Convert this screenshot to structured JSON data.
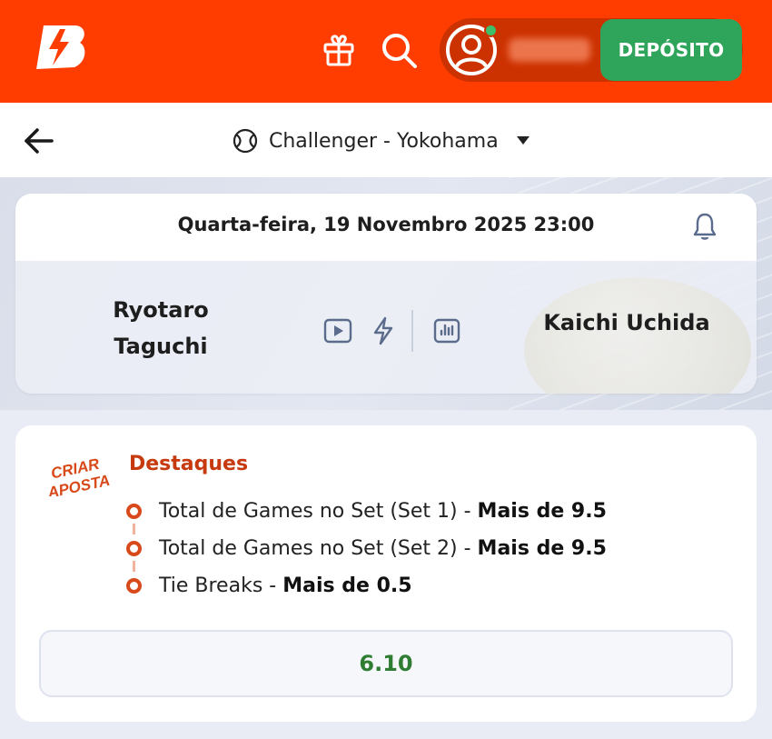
{
  "header": {
    "deposit_label": "DEPÓSITO",
    "accent_color": "#ff3d00",
    "deposit_color": "#2ea55a",
    "icons": [
      "brand-logo-icon",
      "gift-icon",
      "search-icon",
      "user-icon"
    ]
  },
  "subheader": {
    "league": "Challenger - Yokohama",
    "icons": [
      "back-arrow-icon",
      "tennis-ball-icon",
      "caret-down-icon"
    ]
  },
  "event": {
    "datetime": "Quarta-feira, 19 Novembro 2025 23:00",
    "player_home_line1": "Ryotaro",
    "player_home_line2": "Taguchi",
    "player_away": "Kaichi Uchida",
    "icons": [
      "bell-icon",
      "play-video-icon",
      "lightning-icon",
      "stats-icon"
    ]
  },
  "builder": {
    "badge_line1": "CRIAR",
    "badge_line2": "APOSTA",
    "title": "Destaques",
    "legs": [
      {
        "market": "Total de Games no Set (Set 1) - ",
        "selection": "Mais de 9.5"
      },
      {
        "market": "Total de Games no Set (Set 2) - ",
        "selection": "Mais de 9.5"
      },
      {
        "market": "Tie Breaks - ",
        "selection": "Mais de 0.5"
      }
    ],
    "odds": "6.10",
    "accent_color": "#c7390f",
    "odds_color": "#2e7d32"
  }
}
